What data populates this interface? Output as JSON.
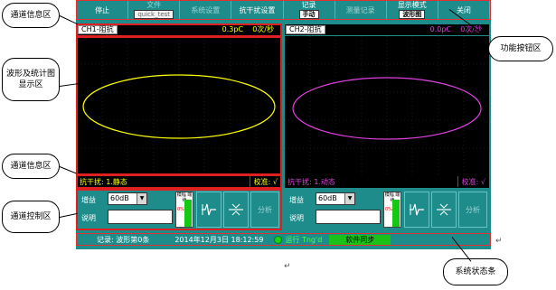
{
  "toolbar": {
    "stop": "停止",
    "file": "文件",
    "file_name": "quick_test",
    "system_settings": "系统设置",
    "anti_interference": "抗干扰设置",
    "record": "记录",
    "record_mode": "手动",
    "measurement_record": "测量记录",
    "display_mode": "显示模式",
    "display_mode_value": "波形图",
    "close": "关闭"
  },
  "channels": [
    {
      "name": "CH1-阻抗",
      "value": "0.3pC",
      "rate": "0次/秒",
      "anti_interference": "抗干扰: 1.静态",
      "calibration": "校准: √",
      "gain_label": "增益",
      "gain_value": "60dB",
      "desc_label": "说明",
      "meter_label": "模幅 端续",
      "meter_pct": "0%",
      "analyze": "分析",
      "color": "#ffff00"
    },
    {
      "name": "CH2-阻抗",
      "value": "0.0pC",
      "rate": "0次/秒",
      "anti_interference": "抗干扰: 1.动态",
      "calibration": "校准: √",
      "gain_label": "增益",
      "gain_value": "60dB",
      "desc_label": "说明",
      "meter_label": "模幅 端续",
      "meter_pct": "0%",
      "analyze": "分析",
      "color": "#e040e0"
    }
  ],
  "status": {
    "record": "记录: 波形第0条",
    "datetime": "2014年12月3日 18:12:59",
    "running": "运行 Tng'd",
    "sync": "软件同步"
  },
  "callouts": {
    "channel_info_top": "通道信息区",
    "waveform_area": "波形及统计图显示区",
    "channel_info_bottom": "通道信息区",
    "channel_control": "通道控制区",
    "function_buttons": "功能按钮区",
    "system_status": "系统状态条"
  },
  "colors": {
    "panel": "#1f8c8c",
    "screen": "#000000",
    "annotation": "#e02020",
    "ch1": "#ffff00",
    "ch2": "#e040e0",
    "sync_green": "#19c119"
  }
}
